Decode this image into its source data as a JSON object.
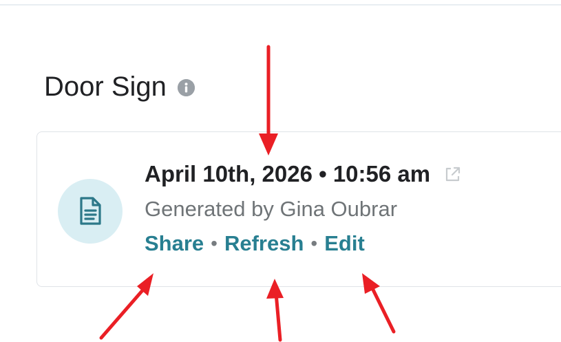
{
  "section": {
    "title": "Door Sign",
    "info_icon": "info-icon"
  },
  "document": {
    "icon": "document-icon",
    "datetime": "April 10th, 2026 • 10:56 am",
    "external_icon": "external-link-icon",
    "generated_by": "Generated by Gina Oubrar",
    "actions": {
      "share": "Share",
      "refresh": "Refresh",
      "edit": "Edit",
      "separator": "•"
    }
  },
  "colors": {
    "annotation_arrow": "#ea1f25",
    "action_link": "#287f91",
    "avatar_background": "#d9eef3",
    "document_icon": "#2c7889"
  }
}
